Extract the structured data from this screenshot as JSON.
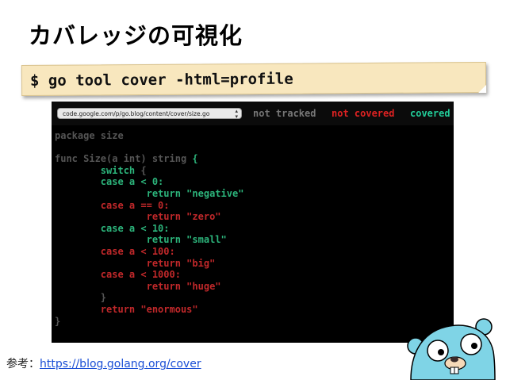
{
  "slide": {
    "title": "カバレッジの可視化",
    "command": "$ go tool cover -html=profile"
  },
  "viewer": {
    "file_select_value": "code.google.com/p/go.blog/content/cover/size.go",
    "legend": {
      "not_tracked": "not tracked",
      "not_covered": "not covered",
      "covered": "covered"
    },
    "colors": {
      "not_tracked": "#555555",
      "not_covered": "#c0282a",
      "covered": "#2cb47b",
      "background": "#000000"
    },
    "code_lines": [
      {
        "segments": [
          {
            "text": "package size",
            "cls": "nt"
          }
        ]
      },
      {
        "segments": [
          {
            "text": "",
            "cls": "nt"
          }
        ]
      },
      {
        "segments": [
          {
            "text": "func Size(a int) string ",
            "cls": "nt"
          },
          {
            "text": "{",
            "cls": "cv"
          }
        ]
      },
      {
        "segments": [
          {
            "text": "        ",
            "cls": "nt"
          },
          {
            "text": "switch",
            "cls": "cv"
          },
          {
            "text": " {",
            "cls": "nt"
          }
        ]
      },
      {
        "segments": [
          {
            "text": "        ",
            "cls": "nt"
          },
          {
            "text": "case a < 0:",
            "cls": "cv"
          }
        ]
      },
      {
        "segments": [
          {
            "text": "                ",
            "cls": "nt"
          },
          {
            "text": "return \"negative\"",
            "cls": "cv"
          }
        ]
      },
      {
        "segments": [
          {
            "text": "        ",
            "cls": "nt"
          },
          {
            "text": "case a == 0:",
            "cls": "nc"
          }
        ]
      },
      {
        "segments": [
          {
            "text": "                ",
            "cls": "nt"
          },
          {
            "text": "return \"zero\"",
            "cls": "nc"
          }
        ]
      },
      {
        "segments": [
          {
            "text": "        ",
            "cls": "nt"
          },
          {
            "text": "case a < 10:",
            "cls": "cv"
          }
        ]
      },
      {
        "segments": [
          {
            "text": "                ",
            "cls": "nt"
          },
          {
            "text": "return \"small\"",
            "cls": "cv"
          }
        ]
      },
      {
        "segments": [
          {
            "text": "        ",
            "cls": "nt"
          },
          {
            "text": "case a < 100:",
            "cls": "nc"
          }
        ]
      },
      {
        "segments": [
          {
            "text": "                ",
            "cls": "nt"
          },
          {
            "text": "return \"big\"",
            "cls": "nc"
          }
        ]
      },
      {
        "segments": [
          {
            "text": "        ",
            "cls": "nt"
          },
          {
            "text": "case a < 1000:",
            "cls": "nc"
          }
        ]
      },
      {
        "segments": [
          {
            "text": "                ",
            "cls": "nt"
          },
          {
            "text": "return \"huge\"",
            "cls": "nc"
          }
        ]
      },
      {
        "segments": [
          {
            "text": "        }",
            "cls": "nt"
          }
        ]
      },
      {
        "segments": [
          {
            "text": "        ",
            "cls": "nt"
          },
          {
            "text": "return \"enormous\"",
            "cls": "nc"
          }
        ]
      },
      {
        "segments": [
          {
            "text": "}",
            "cls": "nt"
          }
        ]
      }
    ]
  },
  "footer": {
    "label": "参考：",
    "link_text": "https://blog.golang.org/cover"
  },
  "gopher_icon": "go-gopher-mascot"
}
